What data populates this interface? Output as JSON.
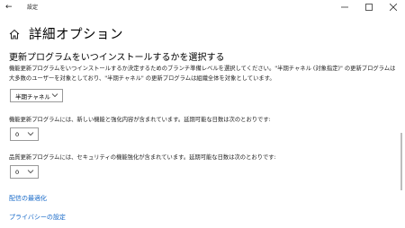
{
  "window": {
    "title": "設定",
    "back_icon": "back-arrow-icon",
    "controls": {
      "minimize": "—",
      "maximize": "☐",
      "close": "✕"
    }
  },
  "header": {
    "icon": "home-icon",
    "title": "詳細オプション"
  },
  "section": {
    "title": "更新プログラムをいつインストールするかを選択する"
  },
  "feature_updates": {
    "description": "機能更新プログラムをいつインストールするか決定するためのブランチ準備レベルを選択してください。\"半期チャネル (対象指定)\" の更新プログラムは大多数のユーザーを対象としており、\"半期チャネル\" の更新プログラムは組織全体を対象としています。",
    "branch_select": "半期チャネル"
  },
  "feature_defer": {
    "description": "機能更新プログラムには、新しい機能と強化内容が含まれています。延期可能な日数は次のとおりです:",
    "days_select": "0"
  },
  "quality_defer": {
    "description": "品質更新プログラムには、セキュリティの機能強化が含まれています。延期可能な日数は次のとおりです:",
    "days_select": "0"
  },
  "links": {
    "delivery_optimization": "配信の最適化",
    "privacy_settings": "プライバシーの設定"
  },
  "colors": {
    "link": "#1668c8",
    "border": "#999999"
  }
}
